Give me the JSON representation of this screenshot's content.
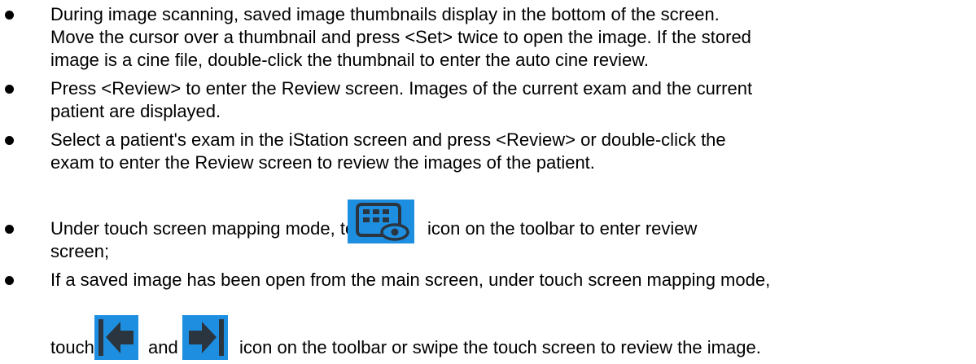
{
  "bullets": [
    {
      "lines": [
        "During image scanning, saved image thumbnails display in the bottom of the screen.",
        "Move the cursor over a thumbnail and press <Set> twice to open the image. If the stored",
        "image is a cine file, double-click the thumbnail to enter the auto cine review."
      ]
    },
    {
      "lines": [
        "Press <Review> to enter the Review screen. Images of the current exam and the current",
        "patient are displayed."
      ]
    },
    {
      "lines": [
        "Select a patient's exam in the iStation screen and press <Review> or double-click the",
        "exam to enter the Review screen to review the images of the patient."
      ]
    },
    {
      "line1_before": "Under touch screen mapping mode, touch",
      "line1_after": "icon on the toolbar to enter review",
      "line2": "screen;",
      "icon": "review-screen-icon"
    },
    {
      "line1": "If a saved image has been open from the main screen, under touch screen mapping mode,",
      "line2_touch": "touch",
      "line2_and": "and",
      "line2_after": "icon on the toolbar or swipe the touch screen to review the image.",
      "icons": [
        "previous-image-icon",
        "next-image-icon"
      ]
    }
  ],
  "colors": {
    "text": "#000000",
    "icon_blue": "#1e8fe0",
    "icon_dark": "#2b3540"
  }
}
